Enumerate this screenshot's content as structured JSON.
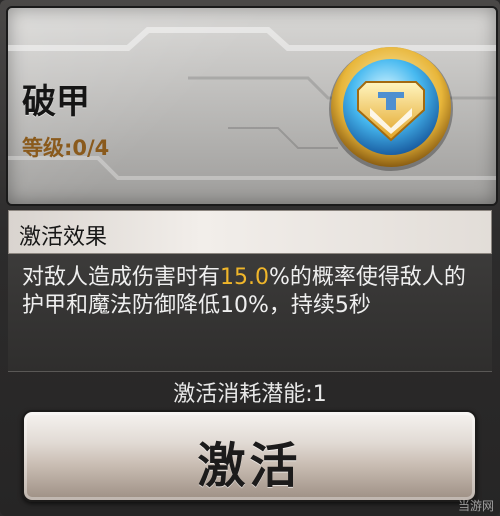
{
  "skill": {
    "name": "破甲",
    "level": "等级:0/4"
  },
  "effect": {
    "title": "激活效果",
    "desc_before": "对敌人造成伤害时有",
    "desc_highlight": "15.0",
    "desc_after": "%的概率使得敌人的护甲和魔法防御降低10%，持续5秒"
  },
  "cost": {
    "text": "激活消耗潜能:1"
  },
  "action": {
    "activate_label": "激活"
  },
  "watermark": "当游网",
  "colors": {
    "highlight": "#f0b62a",
    "level": "#8a5a1c"
  },
  "icons": {
    "skill_emblem": "armor-break-emblem-icon"
  }
}
